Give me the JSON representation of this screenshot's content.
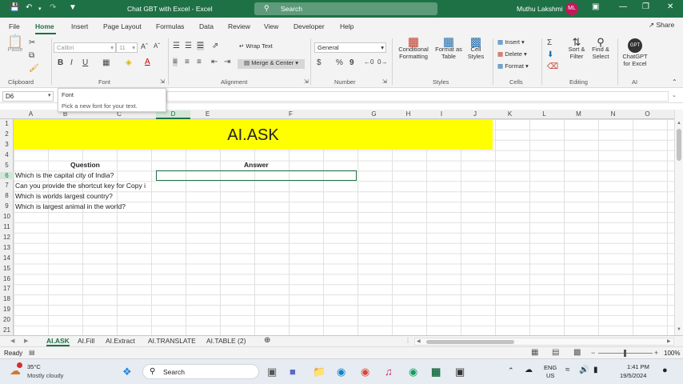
{
  "titlebar": {
    "doc_title": "Chat GBT with Excel  -  Excel",
    "search_placeholder": "Search",
    "user_name": "Muthu Lakshmi",
    "user_initials": "ML"
  },
  "tabs": [
    "File",
    "Home",
    "Insert",
    "Page Layout",
    "Formulas",
    "Data",
    "Review",
    "View",
    "Developer",
    "Help"
  ],
  "share_label": "Share",
  "ribbon": {
    "font_name": "Calibri",
    "font_size": "11",
    "wrap_text": "Wrap Text",
    "merge_center": "Merge & Center",
    "number_format": "General",
    "paste": "Paste",
    "conditional_formatting": "Conditional\nFormatting",
    "format_as_table": "Format as\nTable",
    "cell_styles": "Cell\nStyles",
    "insert": "Insert",
    "delete": "Delete",
    "format": "Format",
    "sort_filter": "Sort &\nFilter",
    "find_select": "Find &\nSelect",
    "chatgpt": "ChatGPT\nfor Excel",
    "gpt_badge": "GPT",
    "groups": [
      "Clipboard",
      "Font",
      "Alignment",
      "Number",
      "Styles",
      "Cells",
      "Editing",
      "AI"
    ]
  },
  "tooltip": {
    "title": "Font",
    "desc": "Pick a new font for your text."
  },
  "namebox": "D6",
  "columns": [
    "A",
    "B",
    "C",
    "D",
    "E",
    "F",
    "G",
    "H",
    "I",
    "J",
    "K",
    "L",
    "M",
    "N",
    "O"
  ],
  "rows": [
    "1",
    "2",
    "3",
    "4",
    "5",
    "6",
    "7",
    "8",
    "9",
    "10",
    "11",
    "12",
    "13",
    "14",
    "15",
    "16",
    "17",
    "18",
    "19",
    "20",
    "21"
  ],
  "sheet": {
    "title": "AI.ASK",
    "question_header": "Question",
    "answer_header": "Answer",
    "questions": [
      "Which is the capital city of India?",
      "Can you provide the shortcut key for Copy i",
      "Which is worlds largest country?",
      "Which is largest animal in the world?"
    ]
  },
  "sheet_tabs": [
    "AI.ASK",
    "AI.Fill",
    "AI.Extract",
    "AI.TRANSLATE",
    "AI.TABLE (2)"
  ],
  "status": {
    "ready": "Ready",
    "zoom": "100%"
  },
  "taskbar": {
    "temp": "35°C",
    "weather": "Mostly cloudy",
    "search": "Search",
    "lang1": "ENG",
    "lang2": "US",
    "time": "1:41 PM",
    "date": "19/5/2024"
  },
  "colors": {
    "excel_green": "#1e7145",
    "highlight": "#ffff00"
  }
}
